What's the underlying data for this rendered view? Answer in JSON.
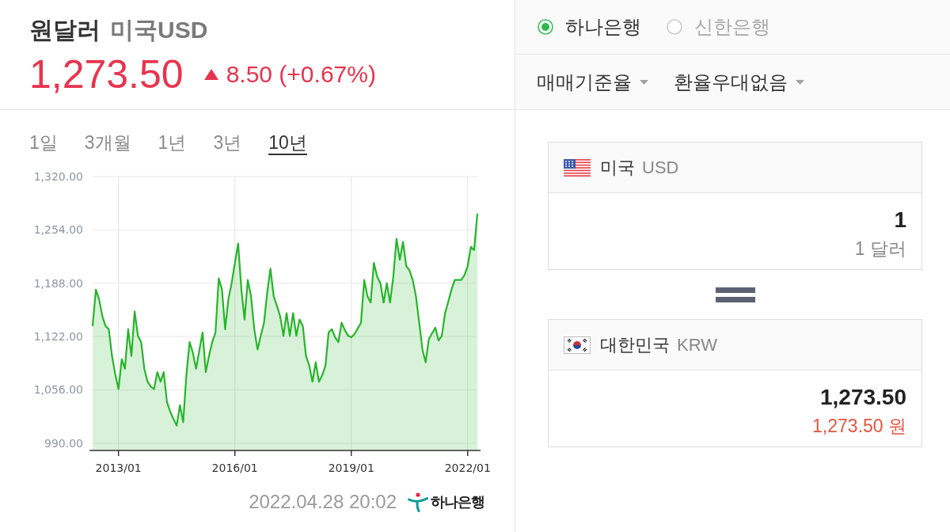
{
  "header": {
    "title": "원달러",
    "subtitle": "미국USD",
    "price": "1,273.50",
    "rising": true,
    "change": "8.50 (+0.67%)"
  },
  "periods": [
    {
      "label": "1일",
      "selected": false
    },
    {
      "label": "3개월",
      "selected": false
    },
    {
      "label": "1년",
      "selected": false
    },
    {
      "label": "3년",
      "selected": false
    },
    {
      "label": "10년",
      "selected": true
    }
  ],
  "chart_data": {
    "type": "area",
    "grid": true,
    "categories": [
      null,
      null,
      null,
      null,
      null,
      null,
      null,
      null,
      "2013/01",
      null,
      null,
      null,
      null,
      null,
      null,
      null,
      null,
      null,
      null,
      null,
      null,
      null,
      null,
      null,
      null,
      null,
      null,
      null,
      null,
      null,
      null,
      null,
      null,
      null,
      null,
      null,
      null,
      null,
      null,
      null,
      null,
      null,
      null,
      null,
      "2016/01",
      null,
      null,
      null,
      null,
      null,
      null,
      null,
      null,
      null,
      null,
      null,
      null,
      null,
      null,
      null,
      null,
      null,
      null,
      null,
      null,
      null,
      null,
      null,
      null,
      null,
      null,
      null,
      null,
      null,
      null,
      null,
      null,
      null,
      null,
      null,
      "2019/01",
      null,
      null,
      null,
      null,
      null,
      null,
      null,
      null,
      null,
      null,
      null,
      null,
      null,
      null,
      null,
      null,
      null,
      null,
      null,
      null,
      null,
      null,
      null,
      null,
      null,
      null,
      null,
      null,
      null,
      null,
      null,
      null,
      null,
      null,
      null,
      "2022/01",
      null,
      null,
      null
    ],
    "series": [
      {
        "color": "#27b52a",
        "values": [
          1135,
          1180,
          1168,
          1147,
          1135,
          1131,
          1098,
          1075,
          1057,
          1094,
          1082,
          1131,
          1098,
          1153,
          1123,
          1115,
          1082,
          1066,
          1060,
          1057,
          1078,
          1066,
          1078,
          1041,
          1029,
          1020,
          1012,
          1037,
          1016,
          1074,
          1115,
          1102,
          1082,
          1105,
          1127,
          1078,
          1098,
          1115,
          1127,
          1194,
          1180,
          1131,
          1168,
          1188,
          1213,
          1237,
          1180,
          1143,
          1192,
          1172,
          1131,
          1106,
          1123,
          1139,
          1176,
          1206,
          1172,
          1160,
          1147,
          1123,
          1151,
          1123,
          1151,
          1123,
          1143,
          1135,
          1098,
          1086,
          1066,
          1090,
          1066,
          1074,
          1086,
          1127,
          1131,
          1121,
          1115,
          1139,
          1130,
          1123,
          1121,
          1125,
          1132,
          1139,
          1192,
          1172,
          1164,
          1213,
          1196,
          1188,
          1164,
          1188,
          1164,
          1196,
          1243,
          1217,
          1239,
          1209,
          1204,
          1192,
          1172,
          1139,
          1106,
          1090,
          1119,
          1126,
          1133,
          1117,
          1123,
          1151,
          1165,
          1180,
          1192,
          1192,
          1192,
          1198,
          1209,
          1233,
          1229,
          1274
        ]
      }
    ],
    "ylim": [
      981,
      1320
    ],
    "yticks": [
      {
        "value": 990,
        "label": "990.00"
      },
      {
        "value": 1056,
        "label": "1,056.00"
      },
      {
        "value": 1122,
        "label": "1,122.00"
      },
      {
        "value": 1188,
        "label": "1,188.00"
      },
      {
        "value": 1254,
        "label": "1,254.00"
      },
      {
        "value": 1320,
        "label": "1,320.00"
      }
    ]
  },
  "updated": "2022.04.28 20:02",
  "source_logo": "하나은행",
  "banks": [
    {
      "label": "하나은행",
      "selected": true
    },
    {
      "label": "신한은행",
      "selected": false
    }
  ],
  "dropdowns": [
    {
      "label": "매매기준율"
    },
    {
      "label": "환율우대없음"
    }
  ],
  "currencies": [
    {
      "kind": "us",
      "highlighted": false,
      "country": "미국",
      "code": "USD",
      "amount": "1",
      "amount_text": "1 달러"
    },
    {
      "kind": "kr",
      "highlighted": true,
      "country": "대한민국",
      "code": "KRW",
      "amount": "1,273.50",
      "amount_text": "1,273.50 원"
    }
  ]
}
